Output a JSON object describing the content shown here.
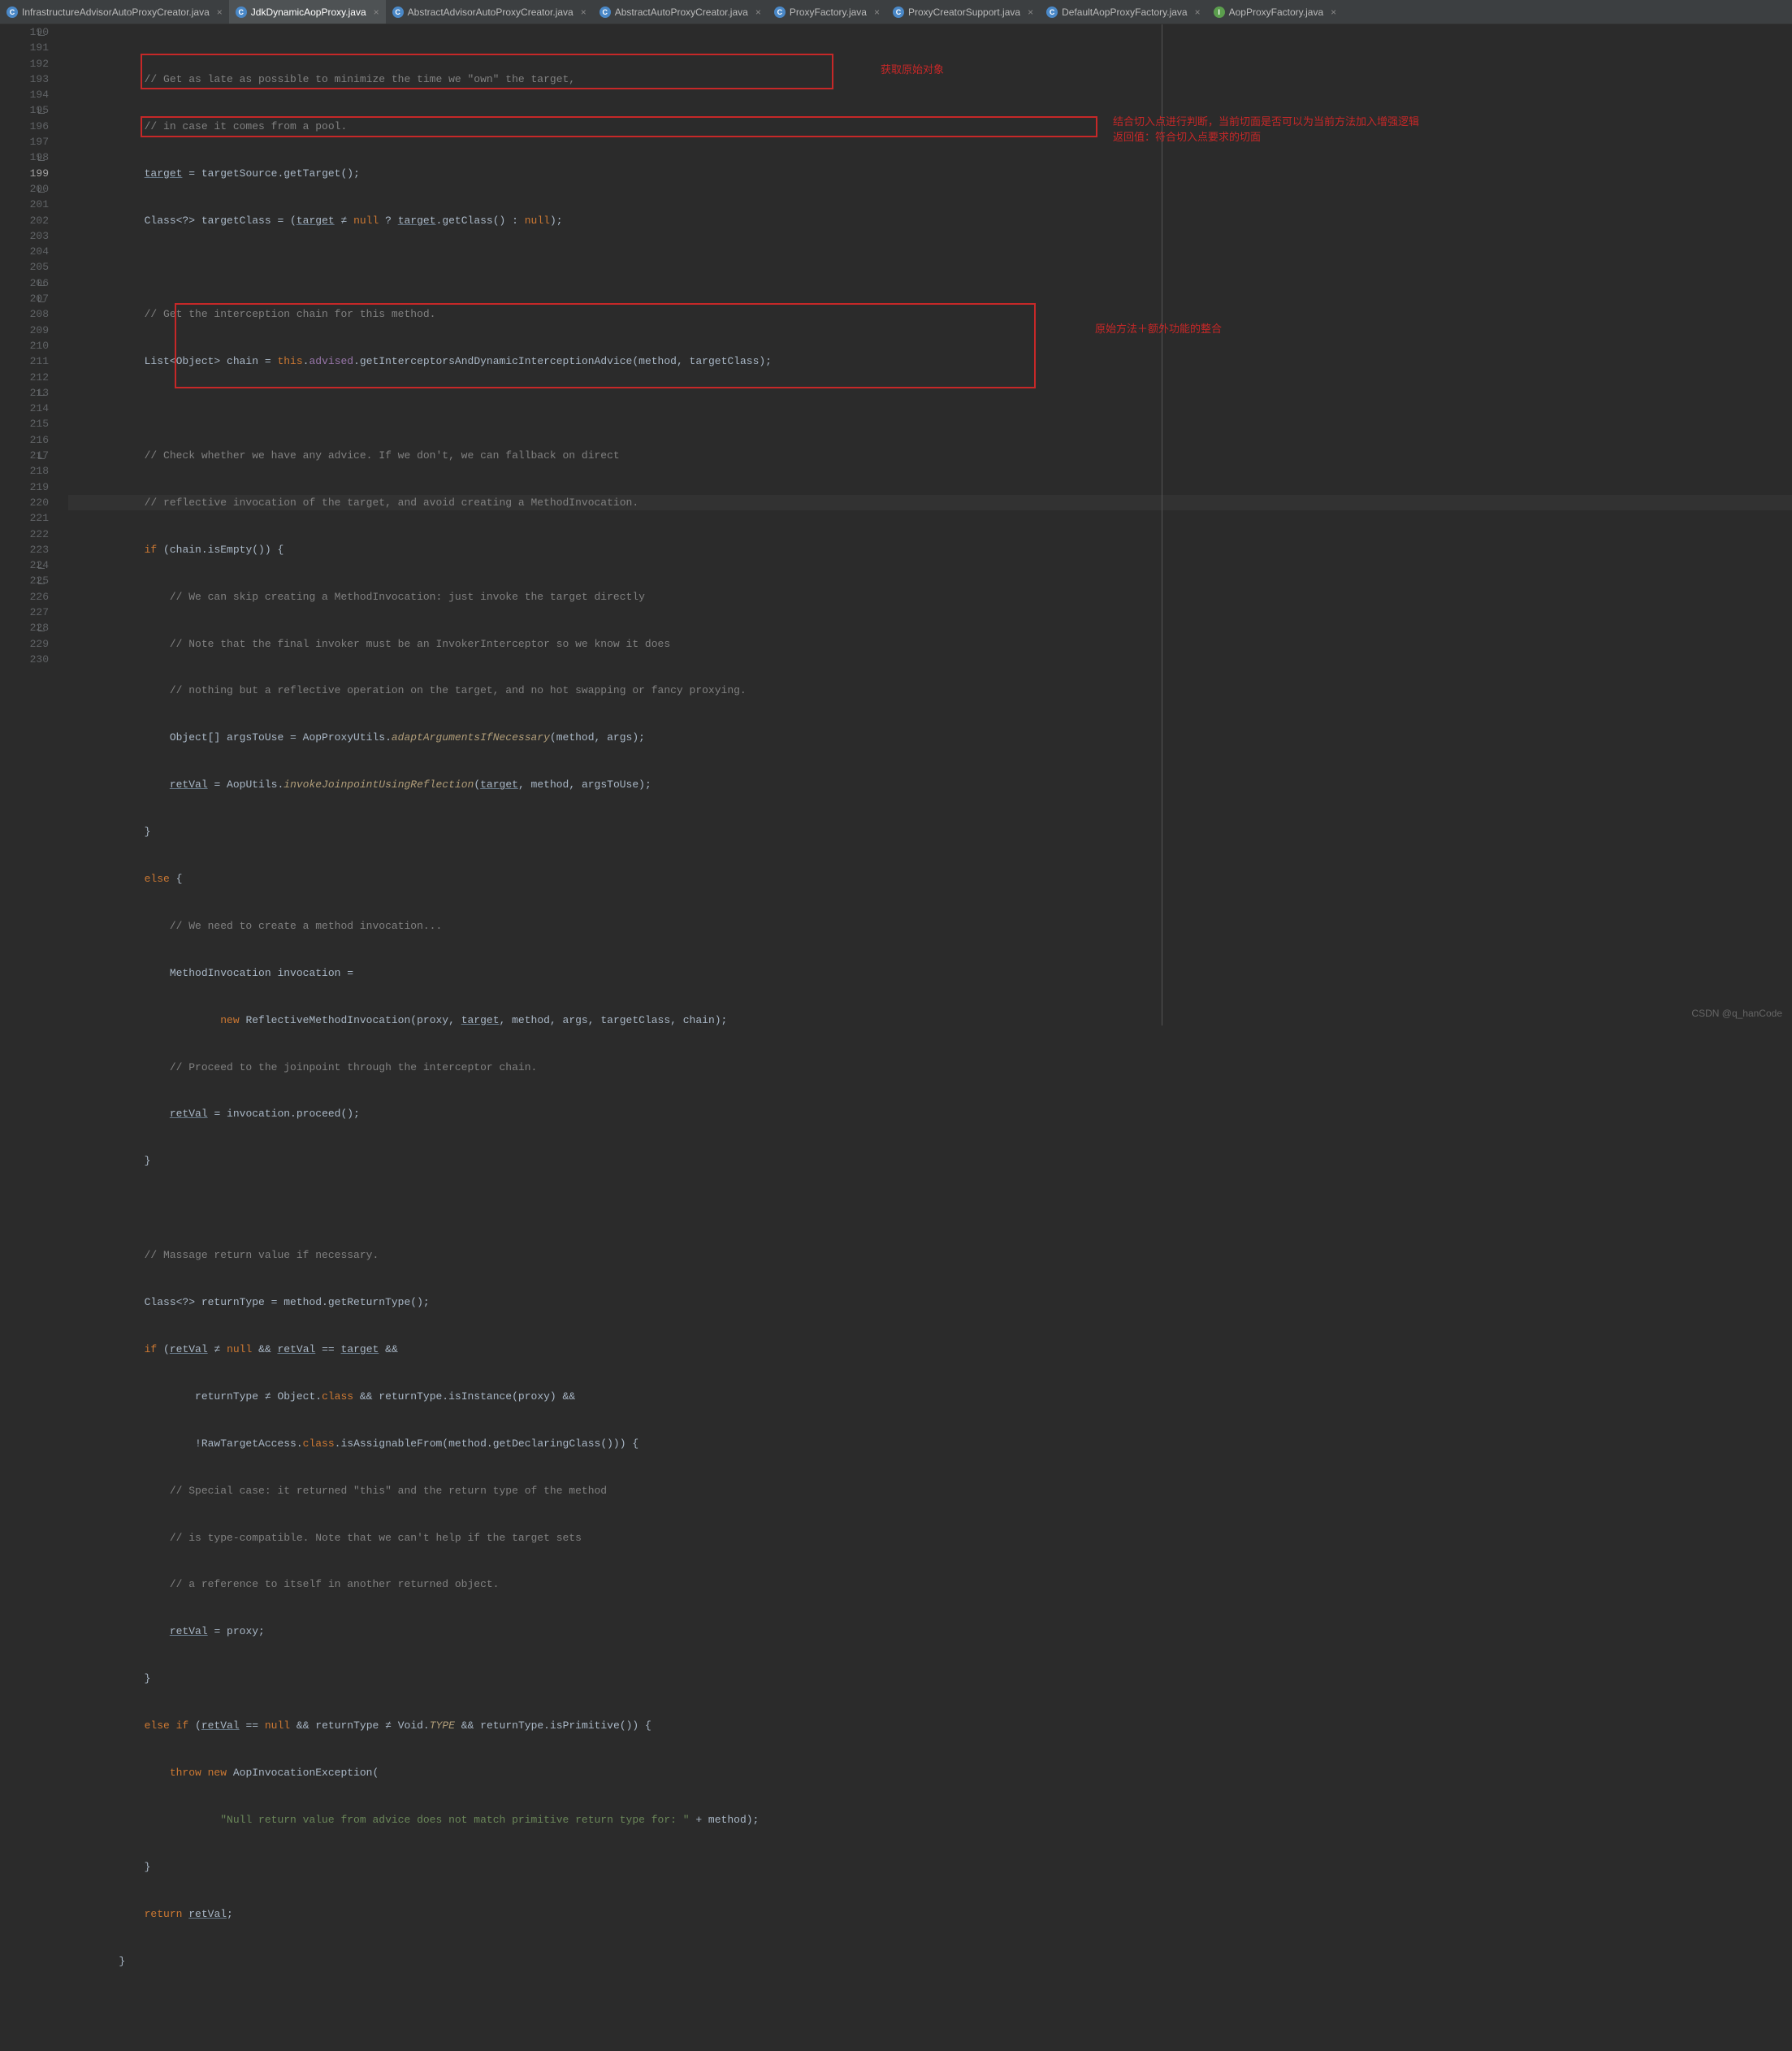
{
  "tabs": [
    {
      "label": "InfrastructureAdvisorAutoProxyCreator.java",
      "iconType": "class",
      "active": false
    },
    {
      "label": "JdkDynamicAopProxy.java",
      "iconType": "class",
      "active": true
    },
    {
      "label": "AbstractAdvisorAutoProxyCreator.java",
      "iconType": "class",
      "active": false
    },
    {
      "label": "AbstractAutoProxyCreator.java",
      "iconType": "class",
      "active": false
    },
    {
      "label": "ProxyFactory.java",
      "iconType": "class",
      "active": false
    },
    {
      "label": "ProxyCreatorSupport.java",
      "iconType": "class",
      "active": false
    },
    {
      "label": "DefaultAopProxyFactory.java",
      "iconType": "class",
      "active": false
    },
    {
      "label": "AopProxyFactory.java",
      "iconType": "interface",
      "active": false
    }
  ],
  "gutter": {
    "start": 190,
    "end": 230,
    "current": 199,
    "foldLines": [
      190,
      195,
      198,
      200,
      206,
      207,
      213,
      217,
      224,
      225,
      228
    ]
  },
  "code": {
    "l190": "            // Get as late as possible to minimize the time we \"own\" the target,",
    "l191": "            // in case it comes from a pool.",
    "l192_a": "            ",
    "l192_b": "target",
    "l192_c": " = targetSource.getTarget();",
    "l193_a": "            Class<?> targetClass = (",
    "l193_b": "target",
    "l193_c": " ≠ ",
    "l193_d": "null",
    "l193_e": " ? ",
    "l193_f": "target",
    "l193_g": ".getClass() : ",
    "l193_h": "null",
    "l193_i": ");",
    "l194": "",
    "l195": "            // Get the interception chain for this method.",
    "l196_a": "            List<Object> chain = ",
    "l196_b": "this",
    "l196_c": ".",
    "l196_d": "advised",
    "l196_e": ".getInterceptorsAndDynamicInterceptionAdvice(method, targetClass);",
    "l197": "",
    "l198": "            // Check whether we have any advice. If we don't, we can fallback on direct",
    "l199": "            // reflective invocation of the target, and avoid creating a MethodInvocation.",
    "l200_a": "            ",
    "l200_b": "if",
    "l200_c": " (chain.isEmpty()) {",
    "l201": "                // We can skip creating a MethodInvocation: just invoke the target directly",
    "l202": "                // Note that the final invoker must be an InvokerInterceptor so we know it does",
    "l203": "                // nothing but a reflective operation on the target, and no hot swapping or fancy proxying.",
    "l204_a": "                Object[] argsToUse = AopProxyUtils.",
    "l204_b": "adaptArgumentsIfNecessary",
    "l204_c": "(method, args);",
    "l205_a": "                ",
    "l205_b": "retVal",
    "l205_c": " = AopUtils.",
    "l205_d": "invokeJoinpointUsingReflection",
    "l205_e": "(",
    "l205_f": "target",
    "l205_g": ", method, argsToUse);",
    "l206": "            }",
    "l207_a": "            ",
    "l207_b": "else ",
    "l207_c": "{",
    "l208": "                // We need to create a method invocation...",
    "l209": "                MethodInvocation invocation =",
    "l210_a": "                        ",
    "l210_b": "new ",
    "l210_c": "ReflectiveMethodInvocation(proxy, ",
    "l210_d": "target",
    "l210_e": ", method, args, targetClass, chain);",
    "l211": "                // Proceed to the joinpoint through the interceptor chain.",
    "l212_a": "                ",
    "l212_b": "retVal",
    "l212_c": " = invocation.proceed();",
    "l213": "            }",
    "l214": "",
    "l215": "            // Massage return value if necessary.",
    "l216": "            Class<?> returnType = method.getReturnType();",
    "l217_a": "            ",
    "l217_b": "if",
    "l217_c": " (",
    "l217_d": "retVal",
    "l217_e": " ≠ ",
    "l217_f": "null",
    "l217_g": " && ",
    "l217_h": "retVal",
    "l217_i": " == ",
    "l217_j": "target",
    "l217_k": " &&",
    "l218_a": "                    returnType ≠ Object.",
    "l218_b": "class",
    "l218_c": " && returnType.isInstance(proxy) &&",
    "l219_a": "                    !RawTargetAccess.",
    "l219_b": "class",
    "l219_c": ".isAssignableFrom(method.getDeclaringClass())) {",
    "l220": "                // Special case: it returned \"this\" and the return type of the method",
    "l221": "                // is type-compatible. Note that we can't help if the target sets",
    "l222": "                // a reference to itself in another returned object.",
    "l223_a": "                ",
    "l223_b": "retVal",
    "l223_c": " = proxy;",
    "l224": "            }",
    "l225_a": "            ",
    "l225_b": "else if",
    "l225_c": " (",
    "l225_d": "retVal",
    "l225_e": " == ",
    "l225_f": "null",
    "l225_g": " && returnType ≠ Void.",
    "l225_h": "TYPE",
    "l225_i": " && returnType.isPrimitive()) {",
    "l226_a": "                ",
    "l226_b": "throw new ",
    "l226_c": "AopInvocationException(",
    "l227_a": "                        ",
    "l227_b": "\"Null return value from advice does not match primitive return type for: \"",
    "l227_c": " + method);",
    "l228": "            }",
    "l229_a": "            ",
    "l229_b": "return ",
    "l229_c": "retVal",
    "l229_d": ";",
    "l230": "        }"
  },
  "annotations": {
    "a1_text": "获取原始对象",
    "a2_text": "结合切入点进行判断，当前切面是否可以为当前方法加入增强逻辑\n返回值：符合切入点要求的切面",
    "a3_text": "原始方法＋额外功能的整合"
  },
  "watermark": "CSDN @q_hanCode"
}
